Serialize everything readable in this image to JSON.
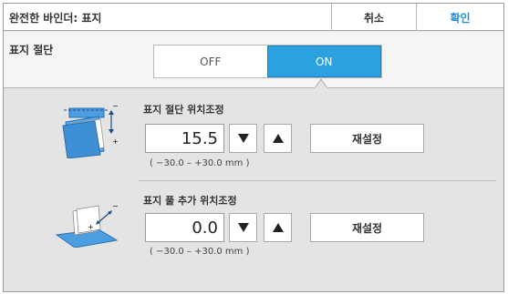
{
  "header": {
    "title": "완전한 바인더: 표지",
    "cancel_label": "취소",
    "ok_label": "확인"
  },
  "cover_cut": {
    "label": "표지 절단",
    "off_label": "OFF",
    "on_label": "ON",
    "selected": "ON"
  },
  "cut_position": {
    "label": "표지 절단 위치조정",
    "value": "15.5",
    "range": "( −30.0 – +30.0 mm )",
    "reset_label": "재설정"
  },
  "glue_position": {
    "label": "표지 풀 추가 위치조정",
    "value": "0.0",
    "range": "( −30.0 – +30.0 mm )",
    "reset_label": "재설정"
  },
  "colors": {
    "accent": "#2ba1e0",
    "ok_text": "#1f8fd6"
  }
}
